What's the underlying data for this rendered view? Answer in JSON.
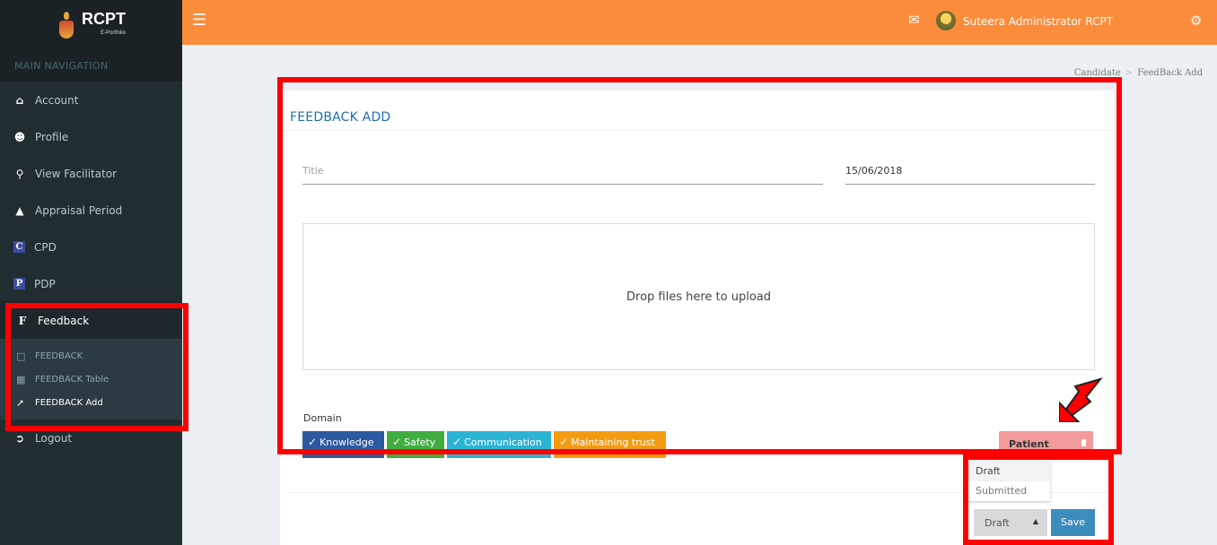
{
  "app": {
    "logo_text": "RCPT",
    "logo_sub": "E-Portfolio"
  },
  "sidebar": {
    "header": "MAIN NAVIGATION",
    "items": [
      {
        "label": "Account",
        "icon": "home-icon"
      },
      {
        "label": "Profile",
        "icon": "user-icon"
      },
      {
        "label": "View Facilitator",
        "icon": "search-icon"
      },
      {
        "label": "Appraisal Period",
        "icon": "area-chart-icon"
      },
      {
        "label": "CPD",
        "icon": "c-letter-icon",
        "glyph": "C"
      },
      {
        "label": "PDP",
        "icon": "p-letter-icon",
        "glyph": "P"
      },
      {
        "label": "Feedback",
        "icon": "f-letter-icon",
        "glyph": "F"
      }
    ],
    "sub_items": [
      {
        "label": "FEEDBACK",
        "icon": "square-outline-icon"
      },
      {
        "label": "FEEDBACK Table",
        "icon": "table-icon"
      },
      {
        "label": "FEEDBACK Add",
        "icon": "magic-wand-icon"
      }
    ],
    "logout": "Logout"
  },
  "topbar": {
    "user_name": "Suteera Administrator RCPT",
    "accent_color": "#fb8c3c"
  },
  "breadcrumb": {
    "items": [
      "Candidate",
      "FeedBack Add"
    ]
  },
  "form": {
    "title": "FEEDBACK ADD",
    "title_placeholder": "Title",
    "date_value": "15/06/2018",
    "dropzone_text": "Drop files here to upload",
    "domain_label": "Domain",
    "domains": [
      {
        "label": "Knowledge",
        "color": "#2c5aa0"
      },
      {
        "label": "Safety",
        "color": "#3fae3f"
      },
      {
        "label": "Communication",
        "color": "#2bb3d4"
      },
      {
        "label": "Maintaining trust",
        "color": "#f39c12"
      }
    ],
    "patient_label": "Patient",
    "status_options": [
      "Draft",
      "Submitted"
    ],
    "status_selected": "Draft",
    "save_label": "Save"
  }
}
